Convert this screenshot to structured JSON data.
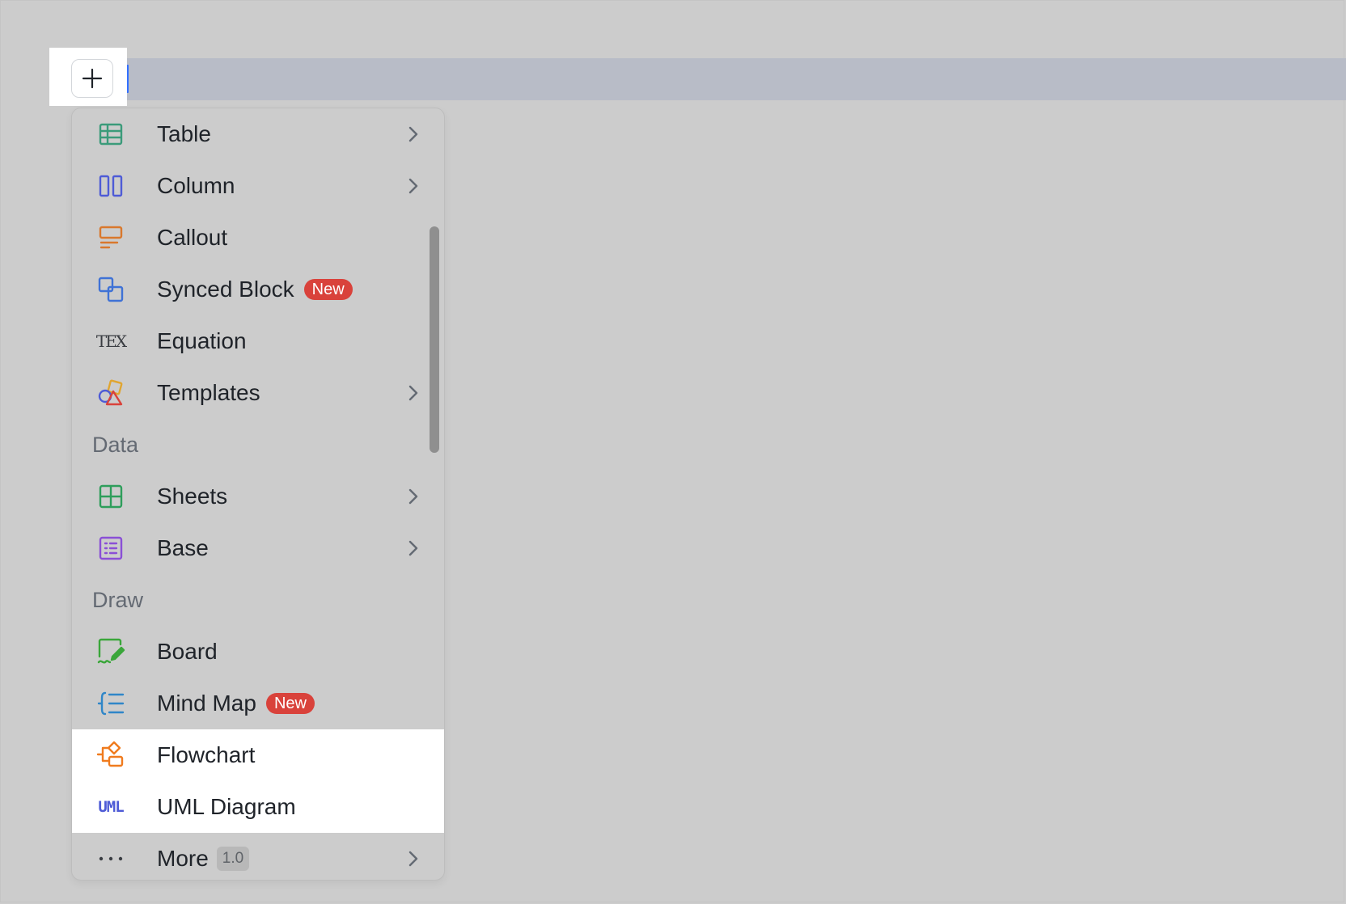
{
  "editor": {
    "add_button_icon": "plus-icon",
    "colors": {
      "background": "#cccccc",
      "line_highlight": "#b8bcc7",
      "caret": "#3370ff",
      "new_badge": "#d9423b"
    }
  },
  "insert_menu": {
    "items": [
      {
        "label": "Table",
        "icon": "table-icon",
        "has_submenu": true
      },
      {
        "label": "Column",
        "icon": "column-icon",
        "has_submenu": true
      },
      {
        "label": "Callout",
        "icon": "callout-icon",
        "has_submenu": false
      },
      {
        "label": "Synced Block",
        "icon": "synced-block-icon",
        "badge": "New",
        "has_submenu": false
      },
      {
        "label": "Equation",
        "icon": "tex-icon",
        "icon_text": "TEX",
        "has_submenu": false
      },
      {
        "label": "Templates",
        "icon": "templates-icon",
        "has_submenu": true
      }
    ],
    "sections": [
      {
        "title": "Data",
        "items": [
          {
            "label": "Sheets",
            "icon": "sheets-icon",
            "has_submenu": true
          },
          {
            "label": "Base",
            "icon": "base-icon",
            "has_submenu": true
          }
        ]
      },
      {
        "title": "Draw",
        "items": [
          {
            "label": "Board",
            "icon": "board-icon",
            "has_submenu": false
          },
          {
            "label": "Mind Map",
            "icon": "mind-map-icon",
            "badge": "New",
            "has_submenu": false
          },
          {
            "label": "Flowchart",
            "icon": "flowchart-icon",
            "highlighted": true,
            "has_submenu": false
          },
          {
            "label": "UML Diagram",
            "icon": "uml-icon",
            "icon_text": "UML",
            "highlighted": true,
            "has_submenu": false
          }
        ]
      }
    ],
    "more": {
      "label": "More",
      "icon": "more-icon",
      "version": "1.0",
      "has_submenu": true
    }
  }
}
